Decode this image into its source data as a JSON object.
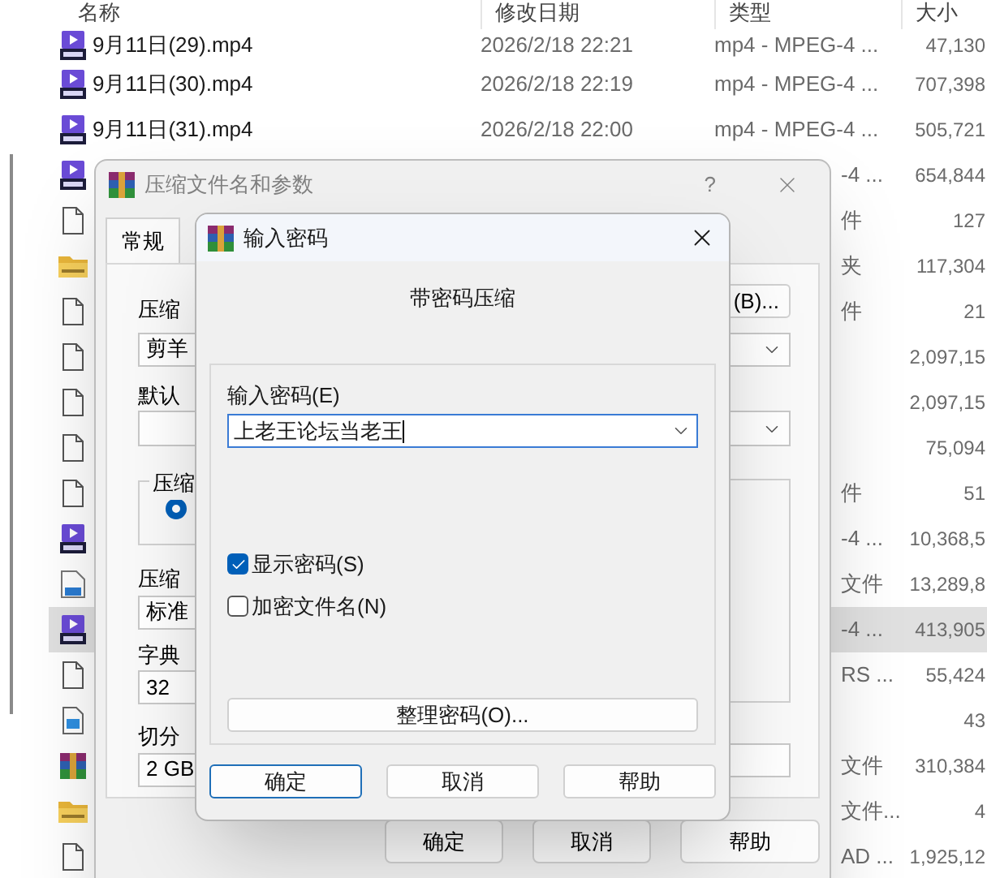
{
  "explorer": {
    "columns": [
      "名称",
      "修改日期",
      "类型",
      "大小"
    ],
    "rows": [
      {
        "kind": "video",
        "name": "9月11日(29).mp4",
        "date": "2026/2/18 22:21",
        "type": "mp4 - MPEG-4 ...",
        "size": "47,130",
        "selected": false
      },
      {
        "kind": "video",
        "name": "9月11日(30).mp4",
        "date": "2026/2/18 22:19",
        "type": "mp4 - MPEG-4 ...",
        "size": "707,398",
        "selected": false
      },
      {
        "kind": "video",
        "name": "9月11日(31).mp4",
        "date": "2026/2/18 22:00",
        "type": "mp4 - MPEG-4 ...",
        "size": "505,721",
        "selected": false
      },
      {
        "kind": "video",
        "type": "-4 ...",
        "size": "654,844",
        "selected": false
      },
      {
        "kind": "file",
        "type": "件",
        "size": "127",
        "selected": false
      },
      {
        "kind": "folder",
        "type": "夹",
        "size": "117,304",
        "selected": false
      },
      {
        "kind": "file",
        "type": "件",
        "size": "21",
        "selected": false
      },
      {
        "kind": "file",
        "size": "2,097,15",
        "selected": false
      },
      {
        "kind": "file",
        "size": "2,097,15",
        "selected": false
      },
      {
        "kind": "file",
        "size": "75,094",
        "selected": false
      },
      {
        "kind": "file",
        "type": "件",
        "size": "51",
        "selected": false
      },
      {
        "kind": "video",
        "type": "-4 ...",
        "size": "10,368,5",
        "selected": false
      },
      {
        "kind": "document",
        "type": "文件",
        "size": "13,289,8",
        "selected": false
      },
      {
        "kind": "video",
        "type": "-4 ...",
        "size": "413,905",
        "selected": true
      },
      {
        "kind": "file",
        "type": "RS ...",
        "size": "55,424",
        "selected": false
      },
      {
        "kind": "image",
        "size": "43",
        "selected": false
      },
      {
        "kind": "archive",
        "type": "文件",
        "size": "310,384",
        "selected": false
      },
      {
        "kind": "folder",
        "type": "文件...",
        "size": "4",
        "selected": false
      },
      {
        "kind": "file",
        "type": "AD ...",
        "size": "1,925,12",
        "selected": false
      }
    ]
  },
  "archive_dialog": {
    "title": "压缩文件名和参数",
    "help": "?",
    "tabs": [
      {
        "label": "常规",
        "selected": true
      }
    ],
    "archive_name_label": "压缩",
    "browse_button": "(B)...",
    "archive_name": "剪羊",
    "profile_label": "默认",
    "format_group": "压缩",
    "format_option": {
      "selected": true
    },
    "method_label": "压缩",
    "method": "标准",
    "dictionary_label": "字典",
    "dictionary": "32",
    "split_label": "切分",
    "split": "2 GB",
    "buttons": [
      "确定",
      "取消",
      "帮助"
    ]
  },
  "password_dialog": {
    "title": "输入密码",
    "heading": "带密码压缩",
    "password_label": "输入密码(E)",
    "password": "上老王论坛当老王",
    "options": [
      {
        "label": "显示密码(S)",
        "checked": true
      },
      {
        "label": "加密文件名(N)",
        "checked": false
      }
    ],
    "organize_button": "整理密码(O)...",
    "buttons": [
      {
        "label": "确定",
        "default": true
      },
      {
        "label": "取消",
        "default": false
      },
      {
        "label": "帮助",
        "default": false
      }
    ]
  }
}
